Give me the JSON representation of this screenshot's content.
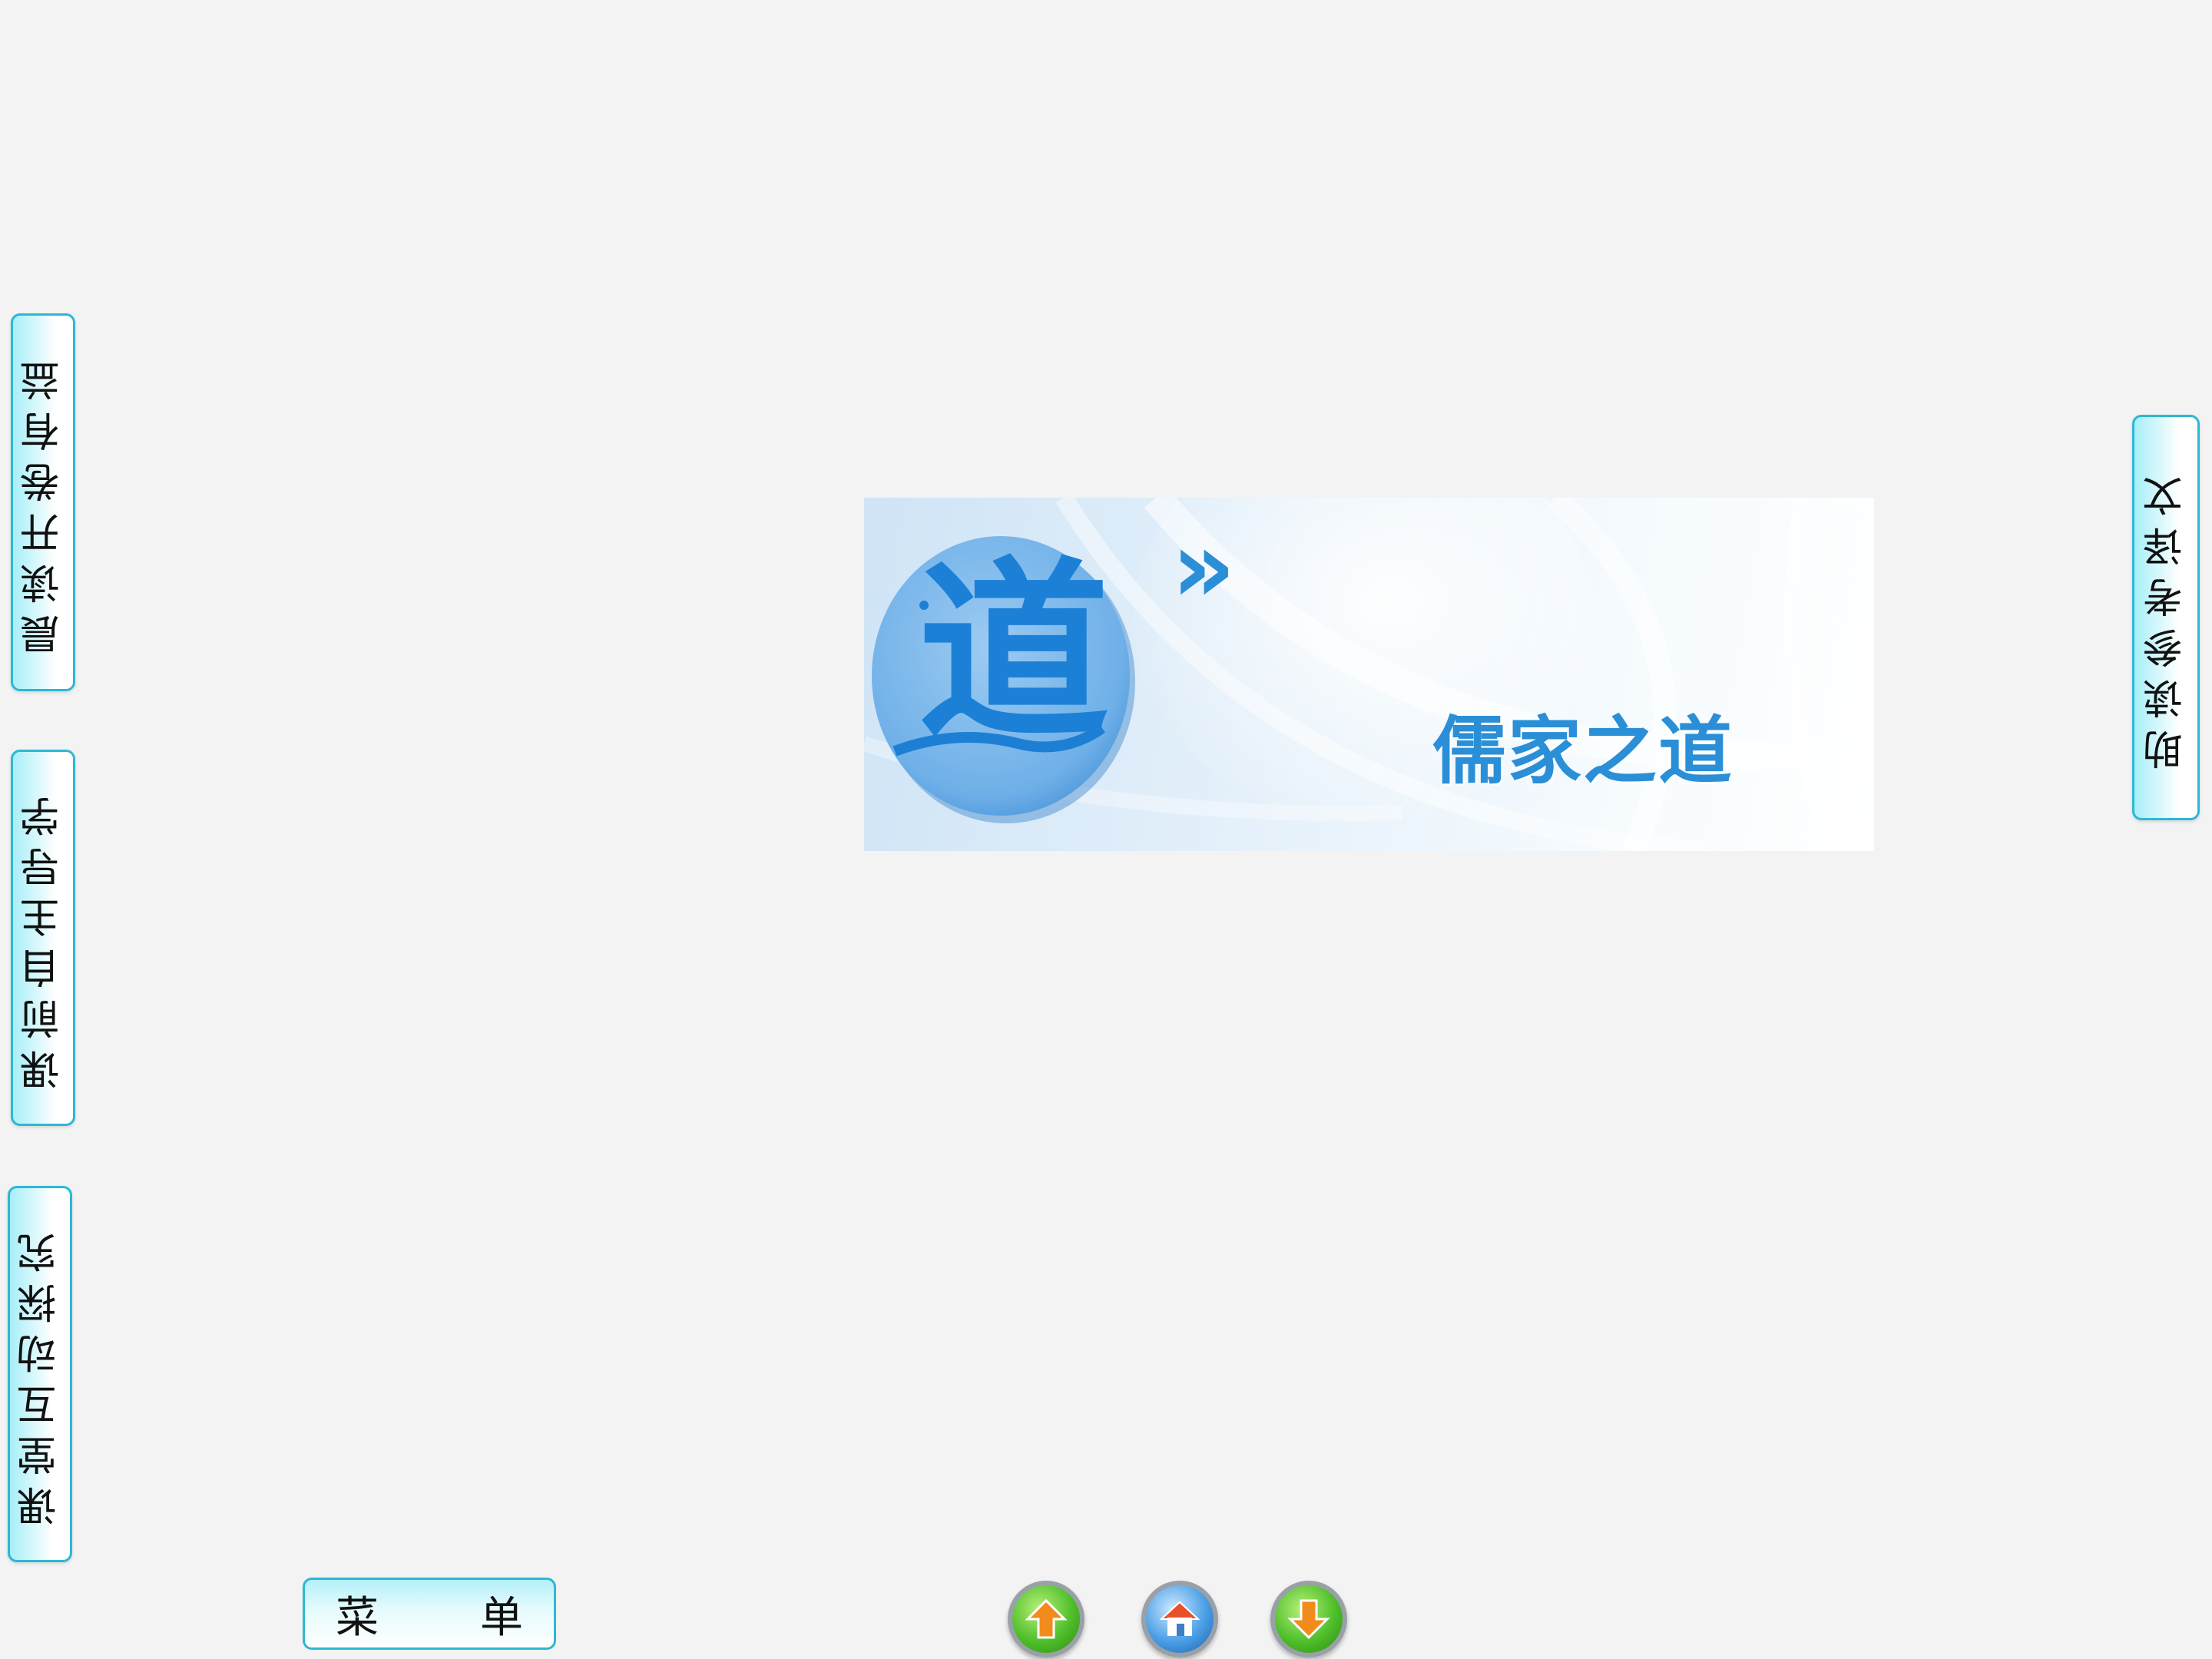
{
  "left_tabs": [
    {
      "label": "晨读开卷有益"
    },
    {
      "label": "课前自主导学"
    },
    {
      "label": "课堂互动探究"
    }
  ],
  "right_tab": {
    "label": "助读参考译文"
  },
  "banner": {
    "seal_char": "道",
    "chevron": "»",
    "title": "儒家之道"
  },
  "menu_button": {
    "char1": "菜",
    "char2": "单"
  },
  "nav": [
    {
      "icon": "up-arrow-icon"
    },
    {
      "icon": "home-icon"
    },
    {
      "icon": "down-arrow-icon"
    }
  ],
  "colors": {
    "accent": "#2cb8d4",
    "banner_blue": "#2a8fd6"
  }
}
